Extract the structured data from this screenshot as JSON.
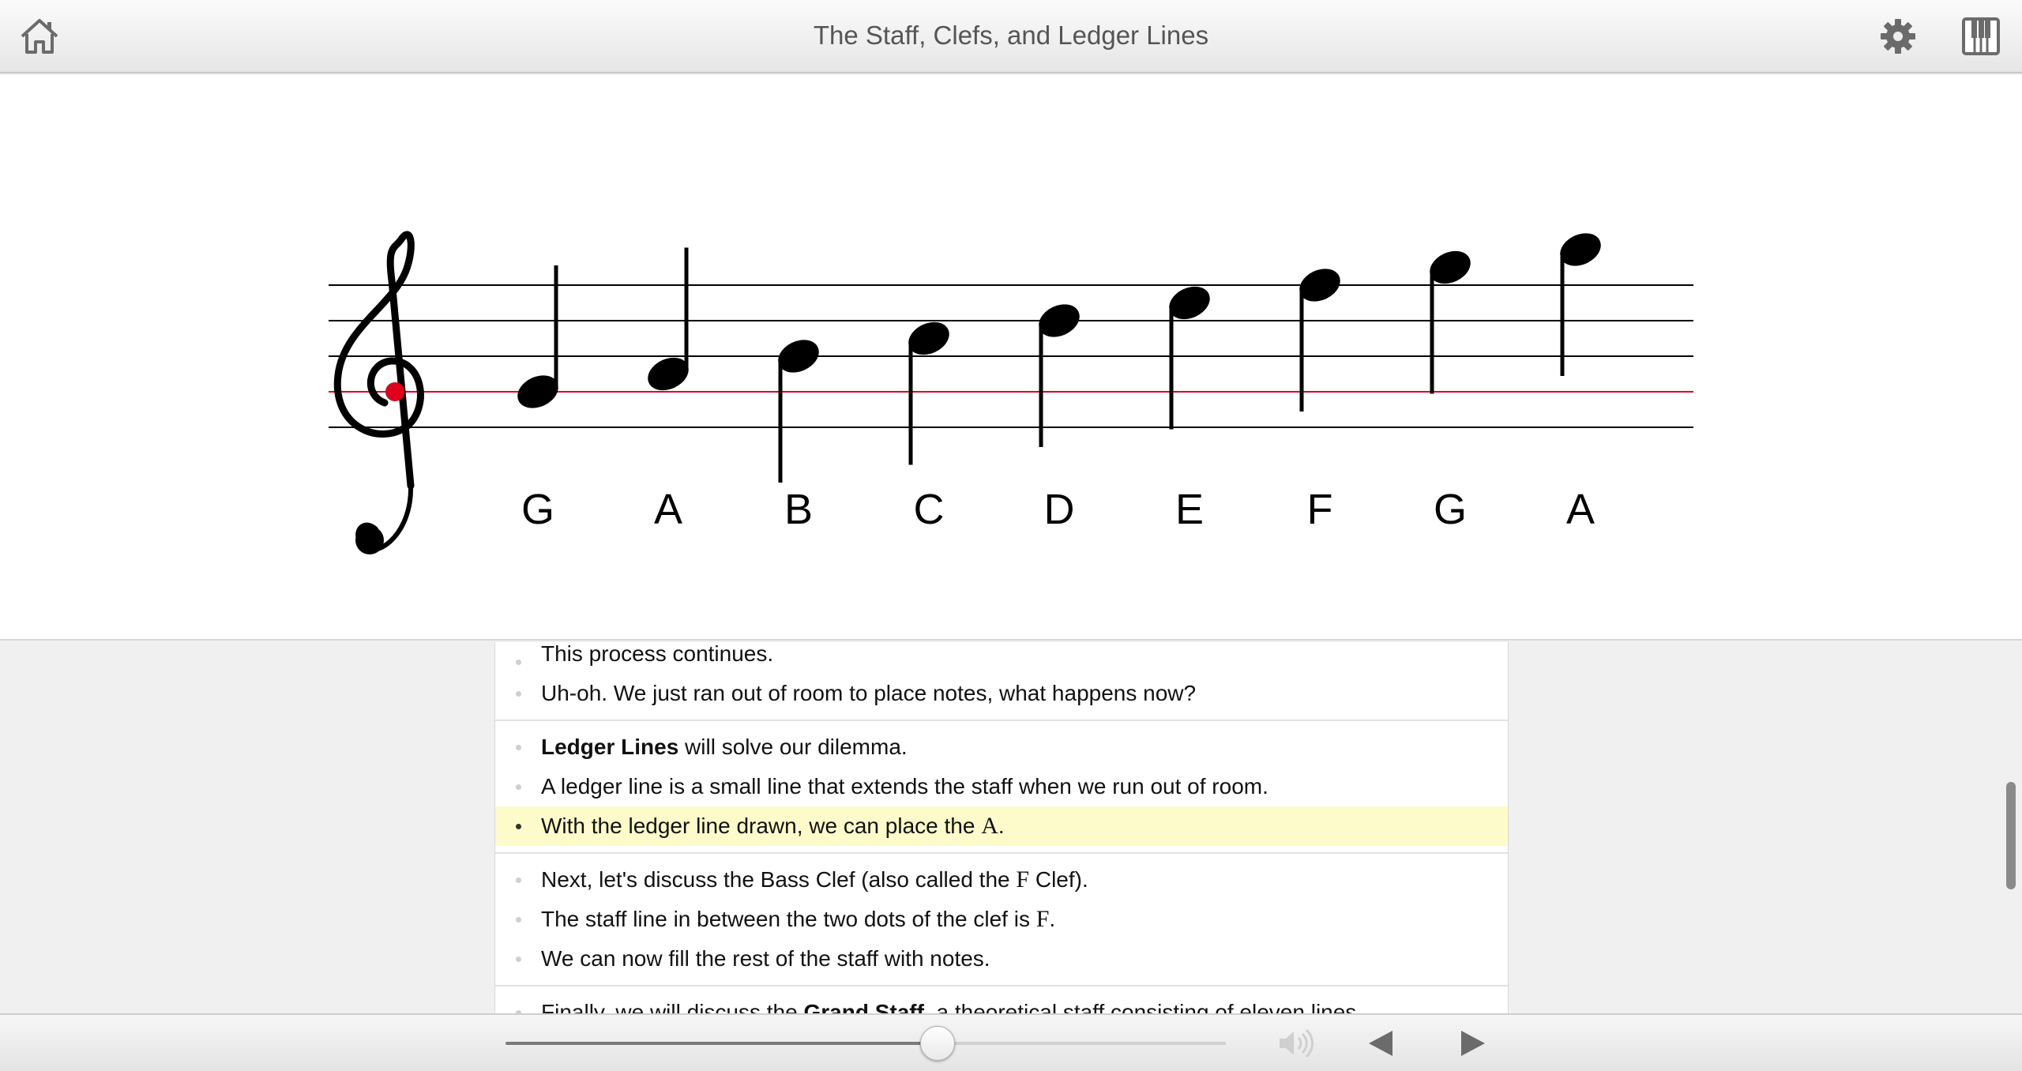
{
  "header": {
    "title": "The Staff, Clefs, and Ledger Lines",
    "home_icon": "home-icon",
    "settings_icon": "gear-icon",
    "piano_icon": "piano-keyboard-icon"
  },
  "staff": {
    "clef": "treble",
    "highlighted_line_color": "#e0001b",
    "notes": [
      {
        "name": "G"
      },
      {
        "name": "A"
      },
      {
        "name": "B"
      },
      {
        "name": "C"
      },
      {
        "name": "D"
      },
      {
        "name": "E"
      },
      {
        "name": "F"
      },
      {
        "name": "G"
      },
      {
        "name": "A"
      }
    ]
  },
  "lesson": {
    "groups": [
      {
        "lines": [
          {
            "text": "This process continues."
          },
          {
            "text": "Uh-oh. We just ran out of room to place notes, what happens now?"
          }
        ]
      },
      {
        "lines": [
          {
            "bold": "Ledger Lines",
            "text": " will solve our dilemma."
          },
          {
            "text": "A ledger line is a small line that extends the staff when we run out of room."
          },
          {
            "text": "With the ledger line drawn, we can place the ",
            "serif": "A",
            "after": ".",
            "active": true
          }
        ]
      },
      {
        "lines": [
          {
            "text": "Next, let's discuss the Bass Clef (also called the ",
            "serif": "F",
            "after": " Clef)."
          },
          {
            "text": "The staff line in between the two dots of the clef is ",
            "serif": "F",
            "after": "."
          },
          {
            "text": "We can now fill the rest of the staff with notes."
          }
        ]
      },
      {
        "lines": [
          {
            "text": "Finally, we will discuss the ",
            "bold_mid": "Grand Staff",
            "after": ", a theoretical staff consisting of eleven lines."
          }
        ]
      }
    ],
    "highlight_color": "#fdfbc9"
  },
  "player": {
    "progress": 0.6,
    "volume_icon": "volume-icon",
    "prev_icon": "previous-triangle-icon",
    "next_icon": "next-triangle-icon"
  }
}
